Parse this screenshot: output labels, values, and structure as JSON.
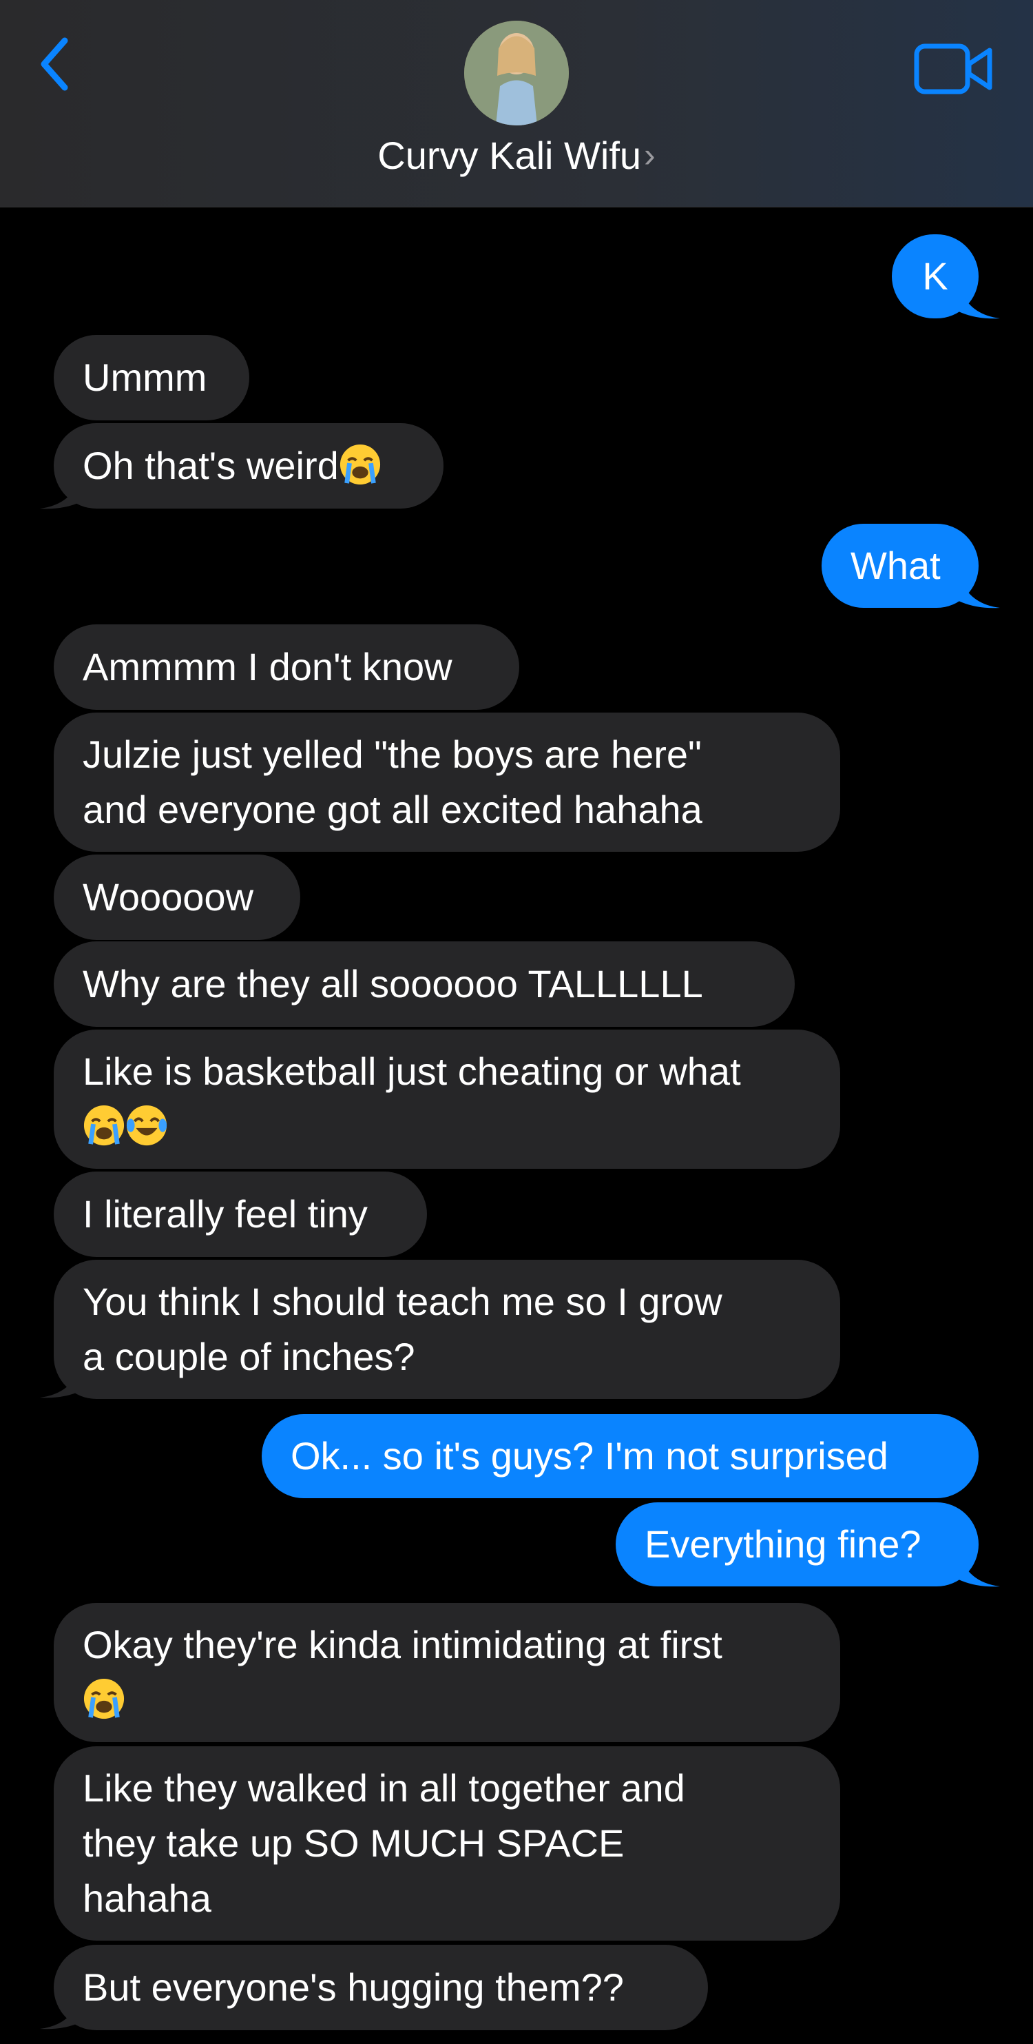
{
  "header": {
    "contact_name": "Curvy Kali Wifu",
    "chevron": "›",
    "back_icon": "chevron-left-icon",
    "video_icon": "video-camera-icon",
    "accent": "#0a84ff"
  },
  "colors": {
    "incoming_bubble": "#262628",
    "outgoing_bubble": "#0a84ff",
    "background": "#000000"
  },
  "messages": [
    {
      "from": "me",
      "lines": [
        "K"
      ]
    },
    {
      "from": "them",
      "lines": [
        "Ummm"
      ]
    },
    {
      "from": "them",
      "lines": [
        "Oh that's weird"
      ],
      "emoji": [
        "loudly-crying-face"
      ]
    },
    {
      "from": "me",
      "lines": [
        "What"
      ]
    },
    {
      "from": "them",
      "lines": [
        "Ammmm I don't know"
      ]
    },
    {
      "from": "them",
      "lines": [
        "Julzie just yelled \"the boys are here\"",
        "and everyone got all excited hahaha"
      ]
    },
    {
      "from": "them",
      "lines": [
        "Wooooow"
      ]
    },
    {
      "from": "them",
      "lines": [
        "Why are they all soooooo TALLLLLL"
      ]
    },
    {
      "from": "them",
      "lines": [
        "Like is basketball just cheating or what",
        ""
      ],
      "emoji": [
        "loudly-crying-face",
        "face-with-tears-of-joy"
      ]
    },
    {
      "from": "them",
      "lines": [
        "I literally feel tiny"
      ]
    },
    {
      "from": "them",
      "lines": [
        "You think I should teach me so I grow",
        "a couple of inches?"
      ]
    },
    {
      "from": "me",
      "lines": [
        "Ok... so it's guys? I'm not surprised"
      ]
    },
    {
      "from": "me",
      "lines": [
        "Everything fine?"
      ]
    },
    {
      "from": "them",
      "lines": [
        "Okay they're kinda intimidating at first",
        ""
      ],
      "emoji": [
        "loudly-crying-face"
      ]
    },
    {
      "from": "them",
      "lines": [
        "Like they walked in all together and",
        "they take up SO MUCH SPACE",
        "hahaha"
      ]
    },
    {
      "from": "them",
      "lines": [
        "But everyone's hugging them??"
      ]
    }
  ]
}
